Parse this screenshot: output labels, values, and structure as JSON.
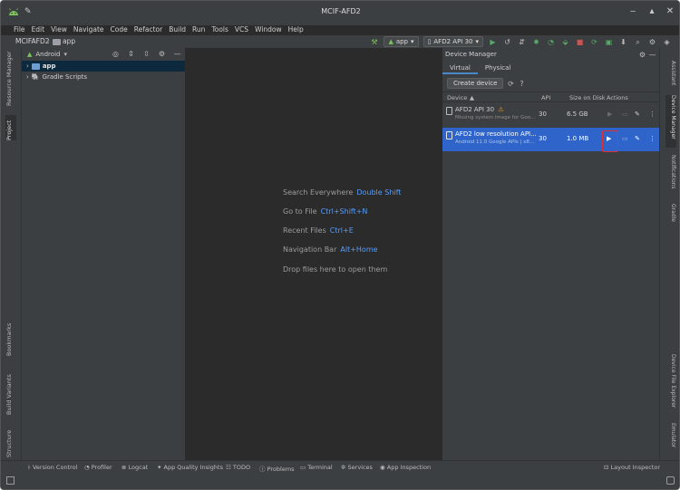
{
  "window": {
    "title": "MCIF-AFD2"
  },
  "menu": [
    "File",
    "Edit",
    "View",
    "Navigate",
    "Code",
    "Refactor",
    "Build",
    "Run",
    "Tools",
    "VCS",
    "Window",
    "Help"
  ],
  "breadcrumb": {
    "project": "MCIFAFD2",
    "module": "app"
  },
  "toolbar": {
    "config": "app",
    "device": "AFD2 API 30"
  },
  "left_tabs": {
    "resource_manager": "Resource Manager",
    "project": "Project",
    "bookmarks": "Bookmarks",
    "build_variants": "Build Variants",
    "structure": "Structure"
  },
  "project_panel": {
    "view_selector": "Android",
    "items": [
      {
        "label": "app"
      },
      {
        "label": "Gradle Scripts"
      }
    ]
  },
  "editor_hints": [
    {
      "text": "Search Everywhere",
      "key": "Double Shift"
    },
    {
      "text": "Go to File",
      "key": "Ctrl+Shift+N"
    },
    {
      "text": "Recent Files",
      "key": "Ctrl+E"
    },
    {
      "text": "Navigation Bar",
      "key": "Alt+Home"
    },
    {
      "text": "Drop files here to open them",
      "key": ""
    }
  ],
  "device_manager": {
    "title": "Device Manager",
    "tabs": [
      "Virtual",
      "Physical"
    ],
    "create_label": "Create device",
    "columns": {
      "device": "Device",
      "api": "API",
      "size": "Size on Disk",
      "actions": "Actions"
    },
    "devices": [
      {
        "name": "AFD2 API 30",
        "subtitle": "Missing system image for Goo...",
        "api": "30",
        "size": "6.5 GB"
      },
      {
        "name": "AFD2 low resolution API...",
        "subtitle": "Android 11.0 Google APIs | x8...",
        "api": "30",
        "size": "1.0 MB"
      }
    ]
  },
  "right_tabs": {
    "assistant": "Assistant",
    "device_manager": "Device Manager",
    "notifications": "Notifications",
    "gradle": "Gradle",
    "device_file_explorer": "Device File Explorer",
    "emulator": "Emulator"
  },
  "bottom_tabs": [
    "Version Control",
    "Profiler",
    "Logcat",
    "App Quality Insights",
    "TODO",
    "Problems",
    "Terminal",
    "Services",
    "App Inspection"
  ],
  "layout_inspector": "Layout Inspector",
  "colors": {
    "accent": "#2f65ca",
    "link": "#589df6",
    "highlight_box": "#e0302f"
  }
}
